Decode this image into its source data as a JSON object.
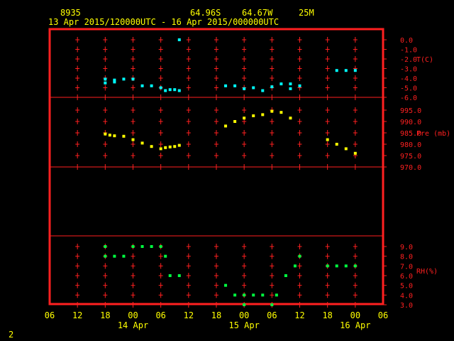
{
  "header": {
    "station": "8935",
    "lat": "64.96S",
    "lon": "64.67W",
    "elev": "25M",
    "period": "13 Apr 2015/120000UTC - 16 Apr 2015/000000UTC"
  },
  "footer": {
    "page_number": "2"
  },
  "colors": {
    "frame": "#ff2020",
    "temp": "#00ffff",
    "pres": "#ffff00",
    "rh": "#00ff40",
    "text": "#ffff00"
  },
  "chart_data": {
    "type": "scatter",
    "x_axis": {
      "unit": "UTC hours",
      "range": [
        "2015-04-13 06:00",
        "2015-04-16 06:00"
      ],
      "tick_labels": [
        "06",
        "12",
        "18",
        "00",
        "06",
        "12",
        "18",
        "00",
        "06",
        "12",
        "18",
        "00",
        "06"
      ],
      "date_labels": [
        {
          "label": "14 Apr",
          "at": "2015-04-14 00:00"
        },
        {
          "label": "15 Apr",
          "at": "2015-04-15 00:00"
        },
        {
          "label": "16 Apr",
          "at": "2015-04-16 00:00"
        }
      ]
    },
    "panels": [
      {
        "name": "T(C)",
        "ylim": [
          -6,
          0
        ],
        "ticks": [
          0,
          -1,
          -2,
          -3,
          -4,
          -5,
          -6
        ],
        "tick_labels": [
          "0.0",
          "-1.0",
          "-2.0",
          "-3.0",
          "-4.0",
          "-5.0",
          "-6.0"
        ],
        "label_at": -2,
        "color": "#00ffff",
        "points": [
          [
            "2015-04-13 18:00",
            -4.1
          ],
          [
            "2015-04-13 18:00",
            -4.5
          ],
          [
            "2015-04-13 20:00",
            -4.4
          ],
          [
            "2015-04-13 20:00",
            -4.2
          ],
          [
            "2015-04-13 22:00",
            -4.1
          ],
          [
            "2015-04-14 00:00",
            -4.1
          ],
          [
            "2015-04-14 02:00",
            -4.8
          ],
          [
            "2015-04-14 04:00",
            -4.8
          ],
          [
            "2015-04-14 06:00",
            -5.0
          ],
          [
            "2015-04-14 07:00",
            -5.3
          ],
          [
            "2015-04-14 08:00",
            -5.2
          ],
          [
            "2015-04-14 09:00",
            -5.2
          ],
          [
            "2015-04-14 10:00",
            -5.3
          ],
          [
            "2015-04-14 10:00",
            0.0
          ],
          [
            "2015-04-14 20:00",
            -4.8
          ],
          [
            "2015-04-14 22:00",
            -4.8
          ],
          [
            "2015-04-15 00:00",
            -5.1
          ],
          [
            "2015-04-15 02:00",
            -5.0
          ],
          [
            "2015-04-15 04:00",
            -5.3
          ],
          [
            "2015-04-15 06:00",
            -4.9
          ],
          [
            "2015-04-15 08:00",
            -4.6
          ],
          [
            "2015-04-15 10:00",
            -4.6
          ],
          [
            "2015-04-15 10:00",
            -5.1
          ],
          [
            "2015-04-15 12:00",
            -4.8
          ],
          [
            "2015-04-15 20:00",
            -3.2
          ],
          [
            "2015-04-15 22:00",
            -3.2
          ],
          [
            "2015-04-16 00:00",
            -3.2
          ]
        ]
      },
      {
        "name": "Pre (mb)",
        "ylim": [
          970,
          995
        ],
        "ticks": [
          995,
          990,
          985,
          980,
          975,
          970
        ],
        "tick_labels": [
          "995.0",
          "990.0",
          "985.0",
          "980.0",
          "975.0",
          "970.0"
        ],
        "label_at": 985,
        "color": "#ffff00",
        "points": [
          [
            "2015-04-13 18:00",
            984.5
          ],
          [
            "2015-04-13 19:00",
            984.0
          ],
          [
            "2015-04-13 20:00",
            983.7
          ],
          [
            "2015-04-13 22:00",
            983.5
          ],
          [
            "2015-04-14 00:00",
            982.0
          ],
          [
            "2015-04-14 02:00",
            980.5
          ],
          [
            "2015-04-14 04:00",
            979.0
          ],
          [
            "2015-04-14 06:00",
            978.0
          ],
          [
            "2015-04-14 07:00",
            978.5
          ],
          [
            "2015-04-14 08:00",
            978.8
          ],
          [
            "2015-04-14 09:00",
            979.0
          ],
          [
            "2015-04-14 10:00",
            979.5
          ],
          [
            "2015-04-14 20:00",
            988.0
          ],
          [
            "2015-04-14 22:00",
            990.0
          ],
          [
            "2015-04-15 00:00",
            991.5
          ],
          [
            "2015-04-15 02:00",
            992.5
          ],
          [
            "2015-04-15 04:00",
            993.0
          ],
          [
            "2015-04-15 06:00",
            994.5
          ],
          [
            "2015-04-15 08:00",
            994.0
          ],
          [
            "2015-04-15 10:00",
            991.5
          ],
          [
            "2015-04-15 18:00",
            982.0
          ],
          [
            "2015-04-15 20:00",
            980.0
          ],
          [
            "2015-04-15 22:00",
            978.0
          ],
          [
            "2015-04-16 00:00",
            976.0
          ]
        ]
      },
      {
        "name": "RH(%)",
        "ylim": [
          3,
          9
        ],
        "ticks": [
          9,
          8,
          7,
          6,
          5,
          4,
          3
        ],
        "tick_labels": [
          "9.0",
          "8.0",
          "7.0",
          "6.0",
          "5.0",
          "4.0",
          "3.0"
        ],
        "label_at": 6.5,
        "color": "#00ff40",
        "points": [
          [
            "2015-04-13 18:00",
            9
          ],
          [
            "2015-04-13 18:00",
            8
          ],
          [
            "2015-04-13 20:00",
            8
          ],
          [
            "2015-04-13 22:00",
            8
          ],
          [
            "2015-04-14 00:00",
            9
          ],
          [
            "2015-04-14 02:00",
            9
          ],
          [
            "2015-04-14 04:00",
            9
          ],
          [
            "2015-04-14 06:00",
            9
          ],
          [
            "2015-04-14 07:00",
            8
          ],
          [
            "2015-04-14 08:00",
            6
          ],
          [
            "2015-04-14 10:00",
            6
          ],
          [
            "2015-04-14 20:00",
            5
          ],
          [
            "2015-04-14 22:00",
            4
          ],
          [
            "2015-04-15 00:00",
            4
          ],
          [
            "2015-04-15 00:00",
            3
          ],
          [
            "2015-04-15 02:00",
            4
          ],
          [
            "2015-04-15 04:00",
            4
          ],
          [
            "2015-04-15 06:00",
            3
          ],
          [
            "2015-04-15 07:00",
            4
          ],
          [
            "2015-04-15 09:00",
            6
          ],
          [
            "2015-04-15 11:00",
            7
          ],
          [
            "2015-04-15 12:00",
            8
          ],
          [
            "2015-04-15 18:00",
            7
          ],
          [
            "2015-04-15 20:00",
            7
          ],
          [
            "2015-04-15 22:00",
            7
          ],
          [
            "2015-04-16 00:00",
            7
          ]
        ]
      }
    ]
  }
}
